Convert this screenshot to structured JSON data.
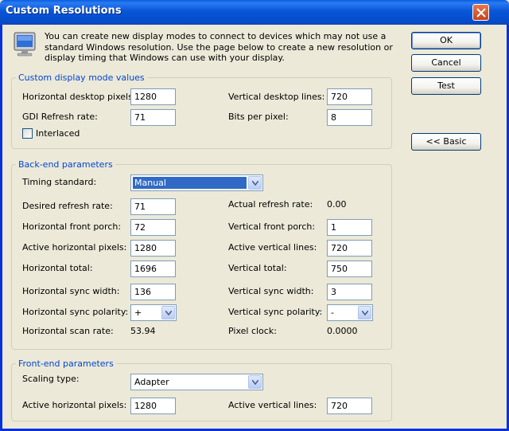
{
  "window": {
    "title": "Custom Resolutions"
  },
  "intro_text": "You can create new display modes to connect to devices which may not use a standard Windows resolution. Use the page below to create a new resolution or display timing that Windows can use with your display.",
  "buttons": {
    "ok": "OK",
    "cancel": "Cancel",
    "test": "Test",
    "basic": "<< Basic"
  },
  "custom_mode": {
    "title": "Custom display mode values",
    "h_desktop_pixels_label": "Horizontal desktop pixels:",
    "h_desktop_pixels": "1280",
    "v_desktop_lines_label": "Vertical desktop lines:",
    "v_desktop_lines": "720",
    "gdi_refresh_label": "GDI Refresh rate:",
    "gdi_refresh": "71",
    "bits_per_pixel_label": "Bits per pixel:",
    "bits_per_pixel": "8",
    "interlaced_label": "Interlaced",
    "interlaced_checked": false
  },
  "backend": {
    "title": "Back-end parameters",
    "timing_standard_label": "Timing standard:",
    "timing_standard": "Manual",
    "desired_refresh_label": "Desired refresh rate:",
    "desired_refresh": "71",
    "actual_refresh_label": "Actual refresh rate:",
    "actual_refresh": "0.00",
    "h_front_porch_label": "Horizontal front porch:",
    "h_front_porch": "72",
    "v_front_porch_label": "Vertical front porch:",
    "v_front_porch": "1",
    "active_h_pixels_label": "Active horizontal pixels:",
    "active_h_pixels": "1280",
    "active_v_lines_label": "Active vertical lines:",
    "active_v_lines": "720",
    "h_total_label": "Horizontal total:",
    "h_total": "1696",
    "v_total_label": "Vertical total:",
    "v_total": "750",
    "h_sync_width_label": "Horizontal sync width:",
    "h_sync_width": "136",
    "v_sync_width_label": "Vertical sync width:",
    "v_sync_width": "3",
    "h_sync_polarity_label": "Horizontal sync polarity:",
    "h_sync_polarity": "+",
    "v_sync_polarity_label": "Vertical sync polarity:",
    "v_sync_polarity": "-",
    "h_scan_rate_label": "Horizontal scan rate:",
    "h_scan_rate": "53.94",
    "pixel_clock_label": "Pixel clock:",
    "pixel_clock": "0.0000"
  },
  "frontend": {
    "title": "Front-end parameters",
    "scaling_type_label": "Scaling type:",
    "scaling_type": "Adapter",
    "active_h_pixels_label": "Active horizontal pixels:",
    "active_h_pixels": "1280",
    "active_v_lines_label": "Active vertical lines:",
    "active_v_lines": "720"
  },
  "colors": {
    "title_bar": "#0a5fe0",
    "group_title": "#0046d5",
    "dialog_bg": "#ece9d8",
    "selection": "#316ac5",
    "close_button": "#e8764e"
  },
  "icons": {
    "monitor": "monitor-icon",
    "close": "close-icon",
    "dropdown": "chevron-down-icon"
  }
}
